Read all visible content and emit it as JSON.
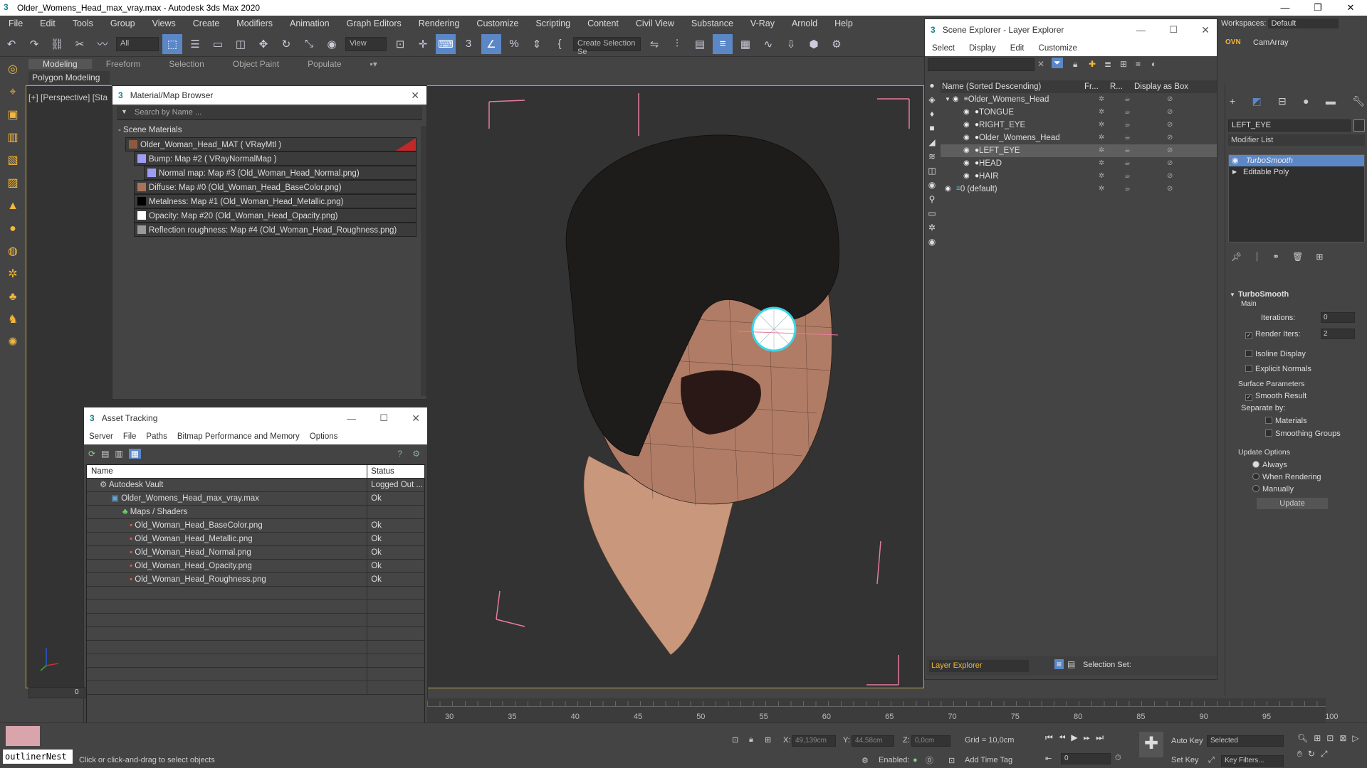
{
  "window": {
    "title": "Older_Womens_Head_max_vray.max - Autodesk 3ds Max 2020",
    "minimize": "—",
    "maximize": "❐",
    "close": "✕"
  },
  "menu": [
    "File",
    "Edit",
    "Tools",
    "Group",
    "Views",
    "Create",
    "Modifiers",
    "Animation",
    "Graph Editors",
    "Rendering",
    "Customize",
    "Scripting",
    "Content",
    "Civil View",
    "Substance",
    "V-Ray",
    "Arnold",
    "Help"
  ],
  "workspace": {
    "label": "Workspaces:",
    "value": "Default"
  },
  "toolbar": {
    "filter": "All",
    "view": "View",
    "selection_set": "Create Selection Se"
  },
  "ribbon": {
    "tabs": [
      "Modeling",
      "Freeform",
      "Selection",
      "Object Paint",
      "Populate"
    ],
    "sub": "Polygon Modeling"
  },
  "viewport_label": "[+] [Perspective] [Sta",
  "material_browser": {
    "title": "Material/Map Browser",
    "search": "Search by Name ...",
    "group": "- Scene Materials",
    "items": [
      "Older_Woman_Head_MAT  ( VRayMtl )",
      "Bump: Map #2  ( VRayNormalMap )",
      "Normal map: Map #3 (Old_Woman_Head_Normal.png)",
      "Diffuse: Map #0 (Old_Woman_Head_BaseColor.png)",
      "Metalness: Map #1 (Old_Woman_Head_Metallic.png)",
      "Opacity: Map #20 (Old_Woman_Head_Opacity.png)",
      "Reflection roughness: Map #4 (Old_Woman_Head_Roughness.png)"
    ]
  },
  "asset_tracking": {
    "title": "Asset Tracking",
    "menu": [
      "Server",
      "File",
      "Paths",
      "Bitmap Performance and Memory",
      "Options"
    ],
    "columns": [
      "Name",
      "Status"
    ],
    "rows": [
      {
        "name": "Autodesk Vault",
        "status": "Logged Out ..."
      },
      {
        "name": "Older_Womens_Head_max_vray.max",
        "status": "Ok"
      },
      {
        "name": "Maps / Shaders",
        "status": ""
      },
      {
        "name": "Old_Woman_Head_BaseColor.png",
        "status": "Ok"
      },
      {
        "name": "Old_Woman_Head_Metallic.png",
        "status": "Ok"
      },
      {
        "name": "Old_Woman_Head_Normal.png",
        "status": "Ok"
      },
      {
        "name": "Old_Woman_Head_Opacity.png",
        "status": "Ok"
      },
      {
        "name": "Old_Woman_Head_Roughness.png",
        "status": "Ok"
      }
    ]
  },
  "scene_explorer": {
    "title": "Scene Explorer - Layer Explorer",
    "menu": [
      "Select",
      "Display",
      "Edit",
      "Customize"
    ],
    "columns": [
      "Name (Sorted Descending)",
      "Fr...",
      "R...",
      "Display as Box"
    ],
    "rows": [
      "Older_Womens_Head",
      "TONGUE",
      "RIGHT_EYE",
      "Older_Womens_Head",
      "LEFT_EYE",
      "HEAD",
      "HAIR",
      "0 (default)"
    ],
    "footer_layer": "Layer Explorer",
    "footer_set": "Selection Set:"
  },
  "command_panel": {
    "camarray": "CamArray",
    "object_name": "LEFT_EYE",
    "modifier_list": "Modifier List",
    "stack": [
      "TurboSmooth",
      "Editable Poly"
    ],
    "rollout": "TurboSmooth",
    "main": "Main",
    "iterations_label": "Iterations:",
    "iterations": "0",
    "render_iters_label": "Render Iters:",
    "render_iters": "2",
    "isoline": "Isoline Display",
    "explicit": "Explicit Normals",
    "surface": "Surface Parameters",
    "smooth_result": "Smooth Result",
    "separate": "Separate by:",
    "materials": "Materials",
    "smoothing_groups": "Smoothing Groups",
    "update_options": "Update Options",
    "always": "Always",
    "when_rendering": "When Rendering",
    "manually": "Manually",
    "update": "Update"
  },
  "timeline": {
    "frame": "0",
    "ticks": [
      "30",
      "35",
      "40",
      "45",
      "50",
      "55",
      "60",
      "65",
      "70",
      "75",
      "80",
      "85",
      "90",
      "95",
      "100"
    ]
  },
  "status": {
    "script": "outlinerNest",
    "prompt": "Click or click-and-drag to select objects",
    "x_label": "X:",
    "x": "49,139cm",
    "y_label": "Y:",
    "y": "44,58cm",
    "z_label": "Z:",
    "z": "0,0cm",
    "grid": "Grid = 10,0cm",
    "enabled": "Enabled:",
    "add_time_tag": "Add Time Tag",
    "auto_key": "Auto Key",
    "selected": "Selected",
    "set_key": "Set Key",
    "key_filters": "Key Filters...",
    "frame_field": "0"
  }
}
